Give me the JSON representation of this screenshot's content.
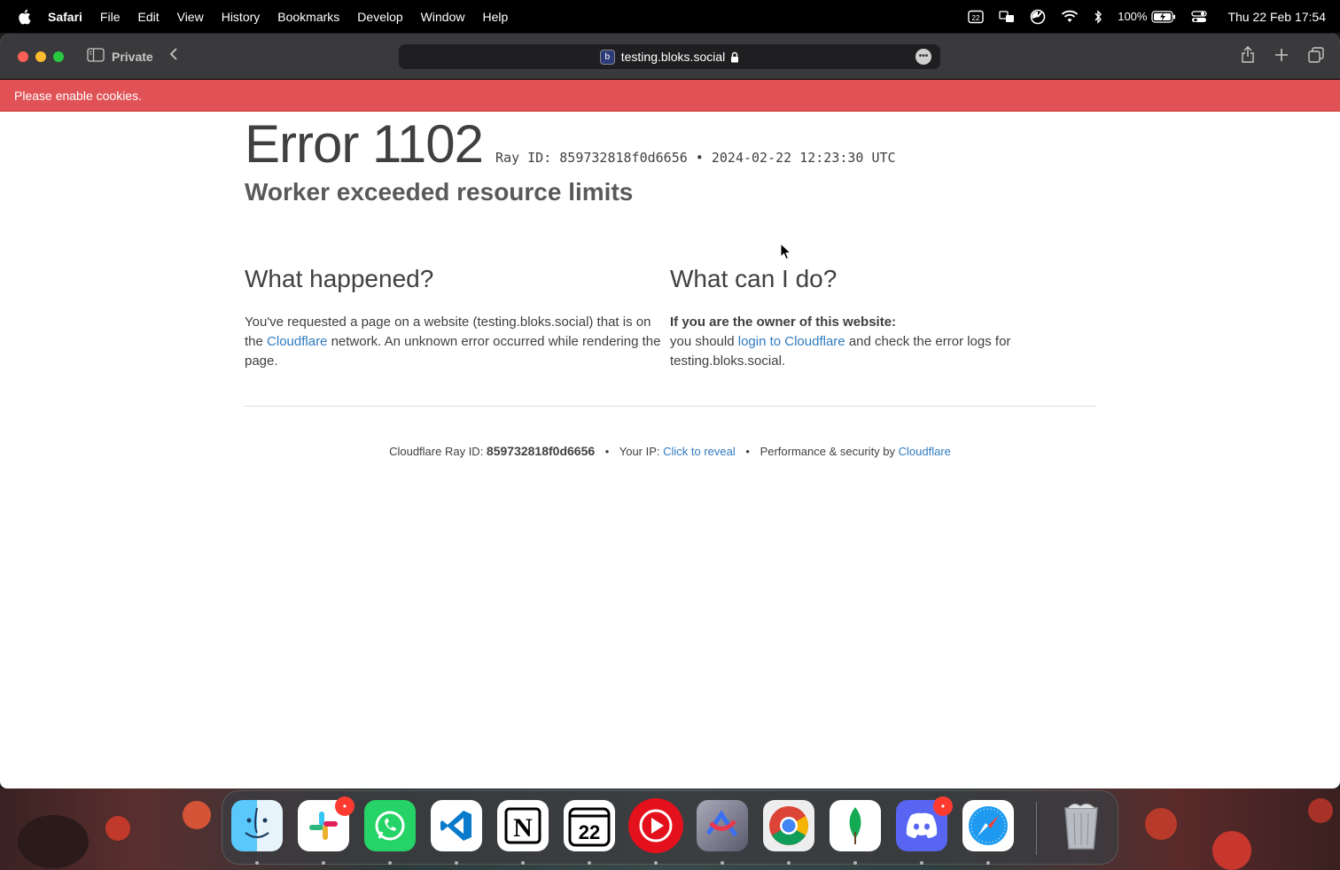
{
  "menubar": {
    "app_name": "Safari",
    "items": [
      "File",
      "Edit",
      "View",
      "History",
      "Bookmarks",
      "Develop",
      "Window",
      "Help"
    ],
    "calendar_day": "22",
    "battery": "100%",
    "clock": "Thu 22 Feb  17:54"
  },
  "browser": {
    "private_label": "Private",
    "url": "testing.bloks.social",
    "favicon_letter": "b"
  },
  "banner": {
    "text": "Please enable cookies."
  },
  "error": {
    "title": "Error 1102",
    "ray_line": "Ray ID: 859732818f0d6656 • 2024-02-22 12:23:30 UTC",
    "subtitle": "Worker exceeded resource limits"
  },
  "what_happened": {
    "heading": "What happened?",
    "text_before": "You've requested a page on a website (testing.bloks.social) that is on the ",
    "link": "Cloudflare",
    "text_after": " network. An unknown error occurred while rendering the page."
  },
  "what_can_i_do": {
    "heading": "What can I do?",
    "owner_label": "If you are the owner of this website:",
    "text_before": "you should ",
    "link": "login to Cloudflare",
    "text_after": " and check the error logs for testing.bloks.social."
  },
  "footer": {
    "ray_label": "Cloudflare Ray ID: ",
    "ray_id": "859732818f0d6656",
    "sep": "•",
    "ip_label": "Your IP: ",
    "ip_link": "Click to reveal",
    "perf_label": "Performance & security by ",
    "perf_link": "Cloudflare"
  },
  "dock": {
    "calendar_day": "22",
    "apps": [
      "finder-icon",
      "slack-icon",
      "whatsapp-icon",
      "vscode-icon",
      "notion-icon",
      "calendar-icon",
      "youtube-icon",
      "affinity-icon",
      "chrome-icon",
      "mongodb-icon",
      "discord-icon",
      "safari-icon",
      "trash-icon"
    ]
  },
  "colors": {
    "banner": "#e05255",
    "link": "#2f7bbf",
    "toolbar": "#3a3a3c"
  }
}
